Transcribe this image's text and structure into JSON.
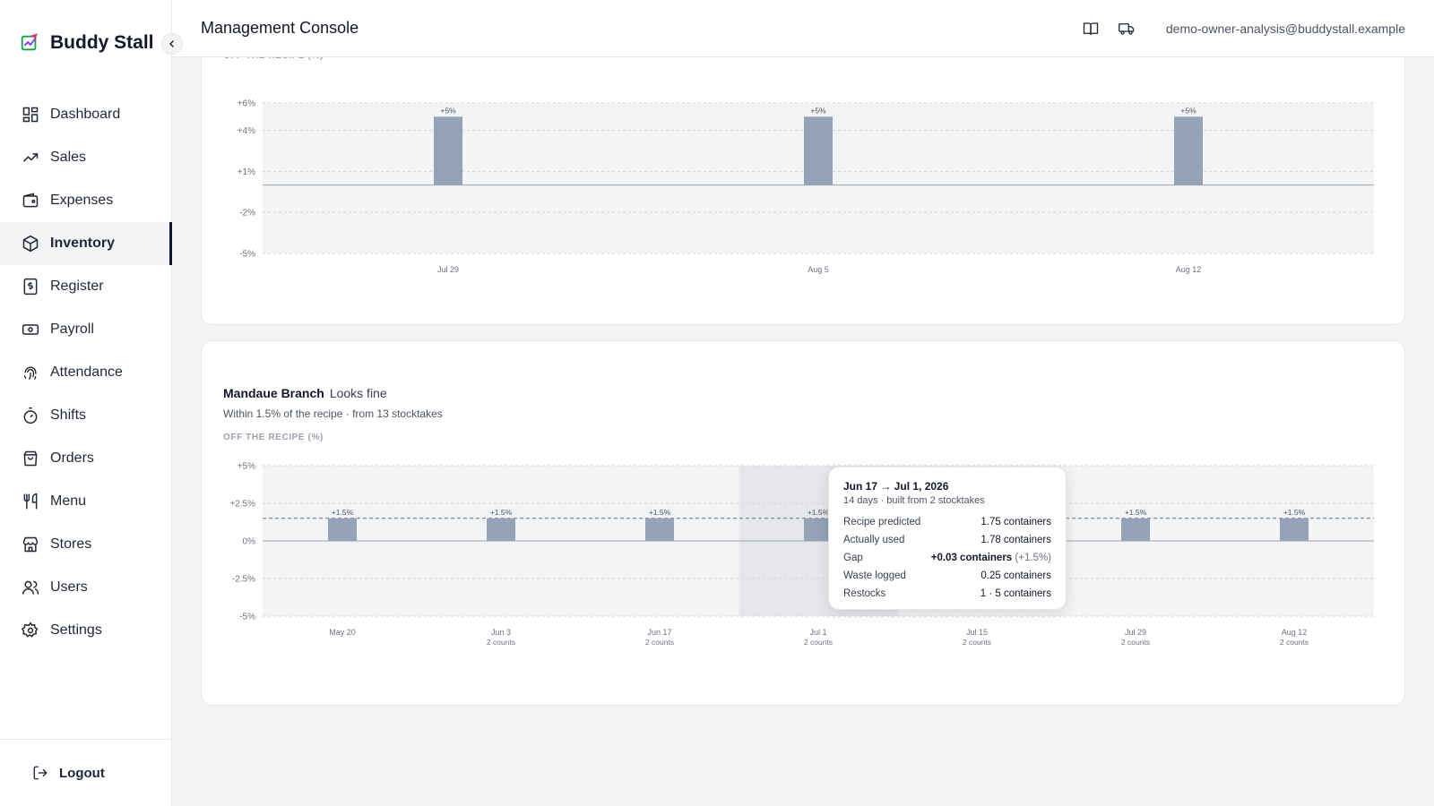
{
  "app": {
    "brand": "Buddy Stall",
    "console_title": "Management Console",
    "user_email": "demo-owner-analysis@buddystall.example"
  },
  "sidebar": {
    "items": [
      {
        "label": "Dashboard",
        "icon": "dashboard-icon"
      },
      {
        "label": "Sales",
        "icon": "trending-up-icon"
      },
      {
        "label": "Expenses",
        "icon": "wallet-icon"
      },
      {
        "label": "Inventory",
        "icon": "box-icon",
        "active": true
      },
      {
        "label": "Register",
        "icon": "register-icon"
      },
      {
        "label": "Payroll",
        "icon": "banknote-icon"
      },
      {
        "label": "Attendance",
        "icon": "fingerprint-icon"
      },
      {
        "label": "Shifts",
        "icon": "timer-icon"
      },
      {
        "label": "Orders",
        "icon": "shopping-bag-icon"
      },
      {
        "label": "Menu",
        "icon": "utensils-icon"
      },
      {
        "label": "Stores",
        "icon": "store-icon"
      },
      {
        "label": "Users",
        "icon": "users-icon"
      },
      {
        "label": "Settings",
        "icon": "gear-icon"
      }
    ],
    "logout_label": "Logout"
  },
  "card1": {
    "partial_label": "OFF THE RECIPE (%)"
  },
  "card2": {
    "branch": "Mandaue Branch",
    "status": "Looks fine",
    "subtitle": "Within 1.5% of the recipe · from 13 stocktakes",
    "chart_label": "OFF THE RECIPE (%)"
  },
  "tooltip": {
    "title": "Jun 17 → Jul 1, 2026",
    "subtitle": "14 days · built from 2 stocktakes",
    "rows": [
      {
        "label": "Recipe predicted",
        "value": "1.75 containers"
      },
      {
        "label": "Actually used",
        "value": "1.78 containers"
      },
      {
        "label": "Gap",
        "value": "+0.03 containers",
        "extra": "(+1.5%)"
      },
      {
        "label": "Waste logged",
        "value": "0.25 containers"
      },
      {
        "label": "Restocks",
        "value": "1 · 5 containers"
      }
    ]
  },
  "colors": {
    "bar": "#94a3b8",
    "plot_bg": "#f3f4f6",
    "highlight": "#e5e7eb"
  },
  "chart_data": [
    {
      "type": "bar",
      "ylabel": "OFF THE RECIPE (%)",
      "yticks": [
        "+6%",
        "+4%",
        "+1%",
        "-2%",
        "-5%"
      ],
      "ylim": [
        -5,
        6
      ],
      "categories": [
        "Jul 29",
        "Aug 5",
        "Aug 12"
      ],
      "values": [
        5,
        5,
        5
      ],
      "data_labels": [
        "+5%",
        "+5%",
        "+5%"
      ],
      "grid": true
    },
    {
      "type": "bar",
      "ylabel": "OFF THE RECIPE (%)",
      "yticks": [
        "+5%",
        "+2.5%",
        "0%",
        "-2.5%",
        "-5%"
      ],
      "ylim": [
        -5,
        5
      ],
      "categories": [
        "May 20",
        "Jun 3",
        "Jun 17",
        "Jul 1",
        "Jul 15",
        "Jul 29",
        "Aug 12"
      ],
      "sublabels": [
        "",
        "2 counts",
        "2 counts",
        "2 counts",
        "2 counts",
        "2 counts",
        "2 counts"
      ],
      "values": [
        1.5,
        1.5,
        1.5,
        1.5,
        1.5,
        1.5,
        1.5
      ],
      "data_labels": [
        "+1.5%",
        "+1.5%",
        "+1.5%",
        "+1.5%",
        "+1.5%",
        "+1.5%",
        "+1.5%"
      ],
      "reference_line": 1.5,
      "highlighted_category": "Jul 1",
      "grid": true
    }
  ]
}
